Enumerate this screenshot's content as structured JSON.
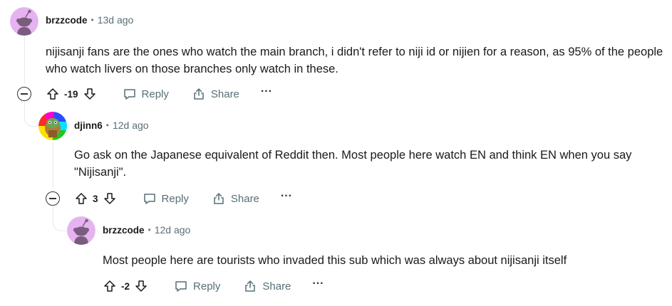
{
  "comments": [
    {
      "username": "brzzcode",
      "time": "13d ago",
      "body": "nijisanji fans are the ones who watch the main branch, i didn't refer to niji id or nijien for a reason, as 95% of the people who watch livers on those branches only watch in these.",
      "votes": "-19",
      "reply_label": "Reply",
      "share_label": "Share",
      "more_label": "···"
    },
    {
      "username": "djinn6",
      "time": "12d ago",
      "body": "Go ask on the Japanese equivalent of Reddit then. Most people here watch EN and think EN when you say \"Nijisanji\".",
      "votes": "3",
      "reply_label": "Reply",
      "share_label": "Share",
      "more_label": "···"
    },
    {
      "username": "brzzcode",
      "time": "12d ago",
      "body": "Most people here are tourists who invaded this sub which was always about nijisanji itself",
      "votes": "-2",
      "reply_label": "Reply",
      "share_label": "Share",
      "more_label": "···"
    }
  ],
  "separator": "•",
  "colors": {
    "avatar_bg": "#e5b3f0",
    "snoo_body": "#7a5c7e",
    "thread_line": "#e5e9ec",
    "meta_gray": "#576f76"
  }
}
